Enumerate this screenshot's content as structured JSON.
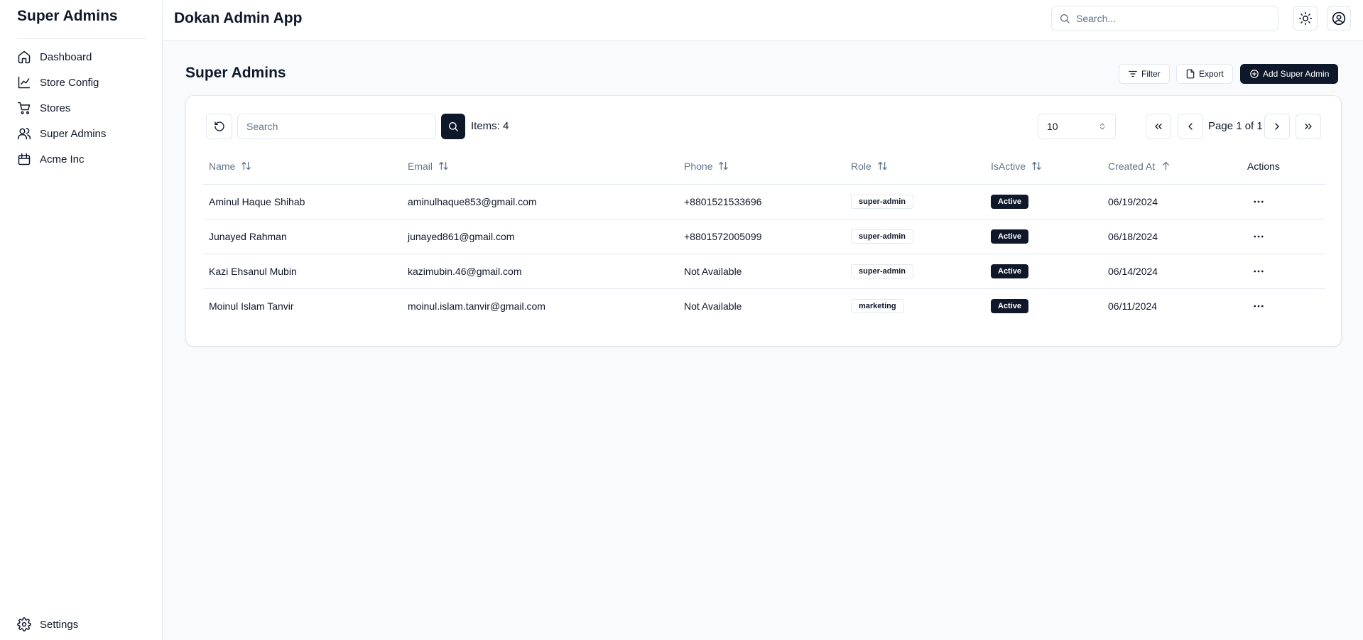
{
  "sidebar": {
    "title": "Super Admins",
    "items": [
      {
        "label": "Dashboard",
        "icon": "home-icon"
      },
      {
        "label": "Store Config",
        "icon": "line-chart-icon"
      },
      {
        "label": "Stores",
        "icon": "shopping-cart-icon"
      },
      {
        "label": "Super Admins",
        "icon": "users-icon"
      },
      {
        "label": "Acme Inc",
        "icon": "package-icon"
      }
    ],
    "settings_label": "Settings"
  },
  "header": {
    "app_title": "Dokan Admin App",
    "search_placeholder": "Search..."
  },
  "main": {
    "page_title": "Super Admins",
    "filter_label": "Filter",
    "export_label": "Export",
    "add_label": "Add Super Admin",
    "table_search_placeholder": "Search",
    "items_count": "Items: 4",
    "page_size": "10",
    "page_label": "Page 1 of 1",
    "columns": [
      "Name",
      "Email",
      "Phone",
      "Role",
      "IsActive",
      "Created At",
      "Actions"
    ],
    "rows": [
      {
        "name": "Aminul Haque Shihab",
        "email": "aminulhaque853@gmail.com",
        "phone": "+8801521533696",
        "role": "super-admin",
        "status": "Active",
        "created": "06/19/2024"
      },
      {
        "name": "Junayed Rahman",
        "email": "junayed861@gmail.com",
        "phone": "+8801572005099",
        "role": "super-admin",
        "status": "Active",
        "created": "06/18/2024"
      },
      {
        "name": "Kazi Ehsanul Mubin",
        "email": "kazimubin.46@gmail.com",
        "phone": "Not Available",
        "role": "super-admin",
        "status": "Active",
        "created": "06/14/2024"
      },
      {
        "name": "Moinul Islam Tanvir",
        "email": "moinul.islam.tanvir@gmail.com",
        "phone": "Not Available",
        "role": "marketing",
        "status": "Active",
        "created": "06/11/2024"
      }
    ]
  },
  "colors": {
    "primary": "#0f172a",
    "muted": "#64748b",
    "border": "#e2e8f0",
    "background": "#f8fafc"
  }
}
